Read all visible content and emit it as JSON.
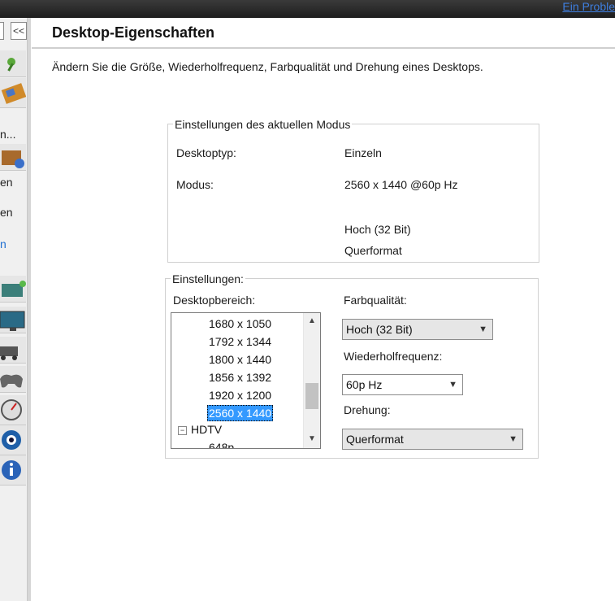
{
  "top_link": "Ein Proble",
  "nav": {
    "collapse_label": "<<",
    "texts": [
      "n...",
      "en",
      "en",
      "n"
    ]
  },
  "header": {
    "title": "Desktop-Eigenschaften",
    "description": "Ändern Sie die Größe, Wiederholfrequenz, Farbqualität und Drehung eines Desktops."
  },
  "current_mode": {
    "legend": "Einstellungen des aktuellen Modus",
    "desktop_type_label": "Desktoptyp:",
    "desktop_type_value": "Einzeln",
    "mode_label": "Modus:",
    "mode_value": "2560 x 1440 @60p Hz",
    "color_value": "Hoch (32 Bit)",
    "rotation_value": "Querformat"
  },
  "settings": {
    "legend": "Einstellungen:",
    "desktop_area_label": "Desktopbereich:",
    "resolutions": [
      "1680 x 1050",
      "1792 x 1344",
      "1800 x 1440",
      "1856 x 1392",
      "1920 x 1200",
      "2560 x 1440"
    ],
    "selected_resolution": "2560 x 1440",
    "group_label": "HDTV",
    "group_box_symbol": "−",
    "partial_item": "648p",
    "color_quality_label": "Farbqualität:",
    "color_quality_value": "Hoch (32 Bit)",
    "refresh_label": "Wiederholfrequenz:",
    "refresh_value": "60p Hz",
    "rotation_label": "Drehung:",
    "rotation_value": "Querformat"
  },
  "colors": {
    "selection": "#3399ff",
    "link": "#3f7fe0"
  }
}
